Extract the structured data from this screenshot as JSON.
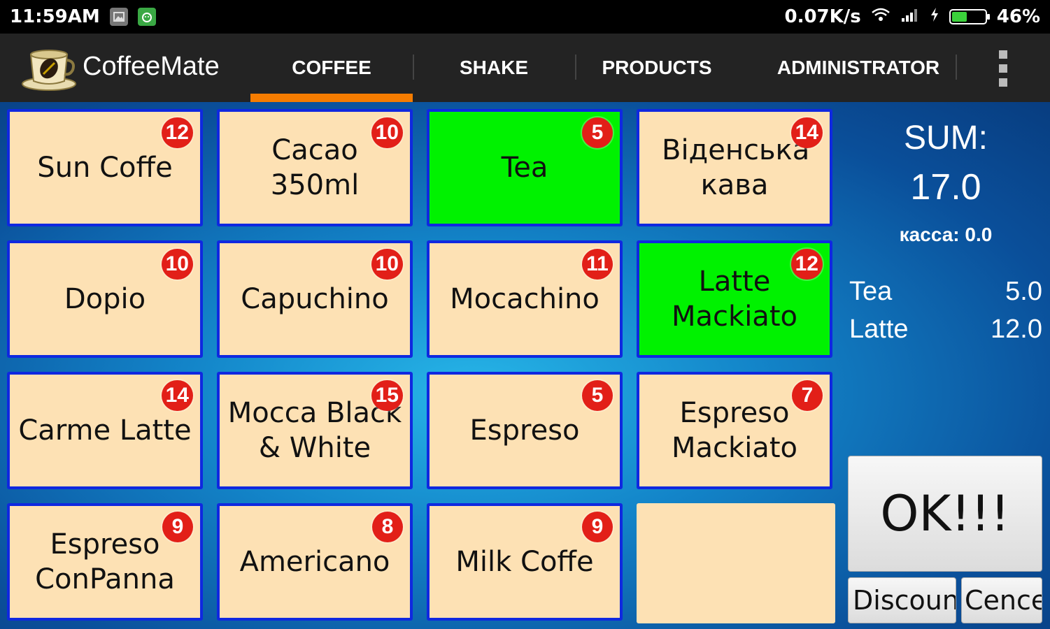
{
  "status_bar": {
    "time": "11:59AM",
    "speed": "0.07K/s",
    "battery_percent": "46%",
    "battery_level": 0.46,
    "icons": [
      "gallery-icon",
      "android-icon",
      "wifi-icon",
      "signal-icon",
      "charging-icon",
      "battery-icon"
    ]
  },
  "app": {
    "title": "CoffeeMate",
    "logo_icon": "coffee-cup-logo"
  },
  "tabs": [
    {
      "label": "COFFEE",
      "active": true
    },
    {
      "label": "SHAKE",
      "active": false
    },
    {
      "label": "PRODUCTS",
      "active": false
    },
    {
      "label": "ADMINISTRATOR",
      "active": false
    }
  ],
  "products": [
    {
      "name": "Sun Coffe",
      "count": "12",
      "selected": false
    },
    {
      "name": "Cacao 350ml",
      "count": "10",
      "selected": false
    },
    {
      "name": "Tea",
      "count": "5",
      "selected": true
    },
    {
      "name": "Віденська кава",
      "count": "14",
      "selected": false
    },
    {
      "name": "Dopio",
      "count": "10",
      "selected": false
    },
    {
      "name": "Capuchino",
      "count": "10",
      "selected": false
    },
    {
      "name": "Mocachino",
      "count": "11",
      "selected": false
    },
    {
      "name": "Latte Mackiato",
      "count": "12",
      "selected": true
    },
    {
      "name": "Carme Latte",
      "count": "14",
      "selected": false
    },
    {
      "name": "Mocca Black & White",
      "count": "15",
      "selected": false
    },
    {
      "name": "Espreso",
      "count": "5",
      "selected": false
    },
    {
      "name": "Espreso Mackiato",
      "count": "7",
      "selected": false
    },
    {
      "name": "Espreso ConPanna",
      "count": "9",
      "selected": false
    },
    {
      "name": "Americano",
      "count": "8",
      "selected": false
    },
    {
      "name": "Milk Coffe",
      "count": "9",
      "selected": false
    }
  ],
  "summary": {
    "label": "SUM:",
    "total": "17.0",
    "kassa": "касса: 0.0",
    "order": [
      {
        "item": "Tea",
        "price": "5.0"
      },
      {
        "item": "Latte",
        "price": "12.0"
      }
    ]
  },
  "buttons": {
    "ok": "OK!!!",
    "discount": "Discoun",
    "cancel": "Cence"
  },
  "colors": {
    "tile": "#fde1b4",
    "tile_selected": "#00f200",
    "tile_border": "#0f28e0",
    "badge": "#e21f18",
    "tab_indicator": "#f57c00",
    "action_bar": "#232323"
  }
}
